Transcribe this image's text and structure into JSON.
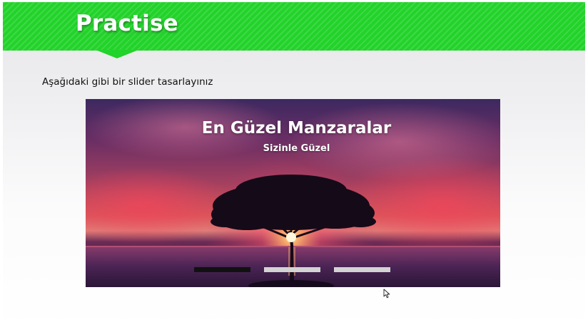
{
  "slide": {
    "title": "Practise",
    "instruction": "Aşağıdaki gibi bir slider tasarlayınız"
  },
  "slider": {
    "headline": "En Güzel Manzaralar",
    "subheadline": "Sizinle Güzel",
    "indicators": [
      {
        "state": "active"
      },
      {
        "state": "inactive"
      },
      {
        "state": "inactive"
      }
    ],
    "image_subject": "tree-at-sunset-over-sea"
  },
  "colors": {
    "banner": "#22d32a",
    "banner_text": "#ffffff",
    "indicator_active": "#111111",
    "indicator_inactive": "#d3d3d3"
  }
}
